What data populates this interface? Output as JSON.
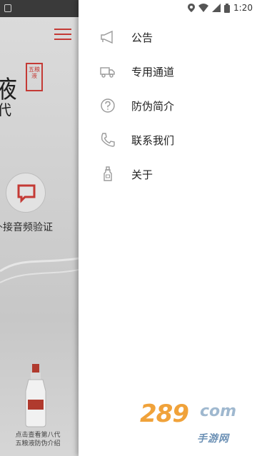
{
  "status_bar": {
    "time": "1:20"
  },
  "background_app": {
    "title_char": "液",
    "subtitle_char": "代",
    "seal_text": "五粮液",
    "verify_label": "扑接音频验证",
    "bottle_caption": "点击查看第八代五粮液防伪介绍",
    "accent_color": "#c43a35"
  },
  "drawer": {
    "items": [
      {
        "label": "公告",
        "icon": "megaphone-icon"
      },
      {
        "label": "专用通道",
        "icon": "truck-icon"
      },
      {
        "label": "防伪简介",
        "icon": "question-icon"
      },
      {
        "label": "联系我们",
        "icon": "phone-icon"
      },
      {
        "label": "关于",
        "icon": "bottle-icon"
      }
    ]
  },
  "watermark": {
    "logo": "289",
    "suffix": "com",
    "text": "手游网"
  }
}
